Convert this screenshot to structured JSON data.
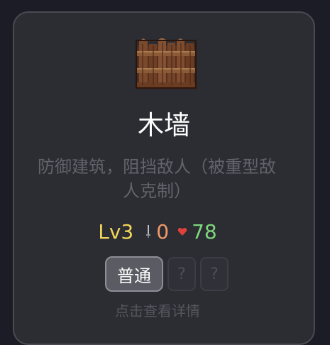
{
  "card": {
    "image_icon": "wooden-fence-icon",
    "name": "木墙",
    "description": "防御建筑，阻挡敌人（被重型敌人克制）",
    "level": "Lv3",
    "attack": "0",
    "hp": "78",
    "attack_icon": "sword-icon",
    "hp_icon": "heart-icon",
    "tags": [
      {
        "label": "普通",
        "state": "selected"
      },
      {
        "label": "?",
        "state": "locked"
      },
      {
        "label": "?",
        "state": "locked"
      }
    ],
    "hint": "点击查看详情"
  },
  "colors": {
    "background": "#1b1c25",
    "card": "#2c2c33",
    "level": "#f2d55a",
    "attack": "#ef9a6a",
    "hp": "#7ed67b",
    "description": "#62636b"
  }
}
